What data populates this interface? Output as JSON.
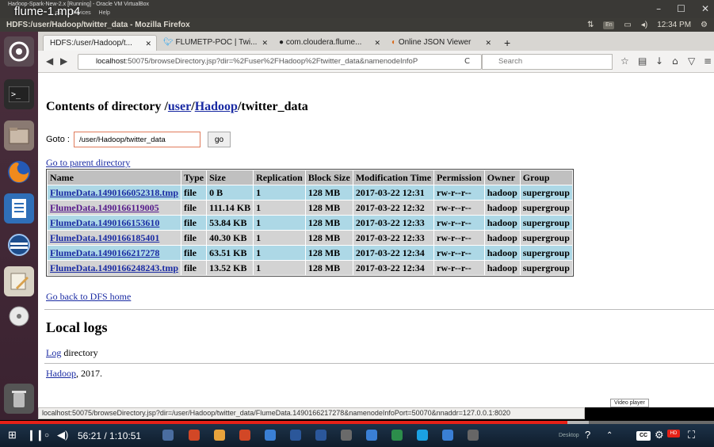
{
  "vbox": {
    "title": "Hadoop-Spark-New-2.x [Running] - Oracle VM VirtualBox",
    "menu": [
      "put",
      "Devices",
      "Help"
    ],
    "video_title": "flume-1.mp4"
  },
  "ubuntu": {
    "window_title": "HDFS:/user/Hadoop/twitter_data - Mozilla Firefox",
    "keyboard": "En",
    "clock": "12:34 PM"
  },
  "tabs": [
    {
      "label": "HDFS:/user/Hadoop/t..."
    },
    {
      "label": "FLUMETP-POC | Twi..."
    },
    {
      "label": "com.cloudera.flume..."
    },
    {
      "label": "Online JSON Viewer"
    }
  ],
  "navbar": {
    "url_host": "localhost",
    "url_rest": ":50075/browseDirectory.jsp?dir=%2Fuser%2FHadoop%2Ftwitter_data&namenodeInfoP",
    "search_placeholder": "Search"
  },
  "page": {
    "heading_prefix": "Contents of directory /",
    "heading_link1": "user",
    "heading_sep": "/",
    "heading_link2": "Hadoop",
    "heading_suffix": "/twitter_data",
    "goto_label": "Goto :",
    "goto_value": "/user/Hadoop/twitter_data",
    "goto_button": "go",
    "parent_link": "Go to parent directory",
    "columns": [
      "Name",
      "Type",
      "Size",
      "Replication",
      "Block Size",
      "Modification Time",
      "Permission",
      "Owner",
      "Group"
    ],
    "rows": [
      [
        "FlumeData.1490166052318.tmp",
        "file",
        "0 B",
        "1",
        "128 MB",
        "2017-03-22 12:31",
        "rw-r--r--",
        "hadoop",
        "supergroup"
      ],
      [
        "FlumeData.1490166119005",
        "file",
        "111.14 KB",
        "1",
        "128 MB",
        "2017-03-22 12:32",
        "rw-r--r--",
        "hadoop",
        "supergroup"
      ],
      [
        "FlumeData.1490166153610",
        "file",
        "53.84 KB",
        "1",
        "128 MB",
        "2017-03-22 12:33",
        "rw-r--r--",
        "hadoop",
        "supergroup"
      ],
      [
        "FlumeData.1490166185401",
        "file",
        "40.30 KB",
        "1",
        "128 MB",
        "2017-03-22 12:33",
        "rw-r--r--",
        "hadoop",
        "supergroup"
      ],
      [
        "FlumeData.1490166217278",
        "file",
        "63.51 KB",
        "1",
        "128 MB",
        "2017-03-22 12:34",
        "rw-r--r--",
        "hadoop",
        "supergroup"
      ],
      [
        "FlumeData.1490166248243.tmp",
        "file",
        "13.52 KB",
        "1",
        "128 MB",
        "2017-03-22 12:34",
        "rw-r--r--",
        "hadoop",
        "supergroup"
      ]
    ],
    "dfs_home": "Go back to DFS home",
    "local_logs": "Local logs",
    "log_link": "Log",
    "log_suffix": " directory",
    "footer_link": "Hadoop",
    "footer_suffix": ", 2017."
  },
  "status_link": "localhost:50075/browseDirectory.jsp?dir=/user/Hadoop/twitter_data/FlumeData.1490166217278&namenodeInfoPort=50070&nnaddr=127.0.0.1:8020",
  "tooltip": "Video player",
  "player": {
    "time": "56:21 / 1:10:51",
    "progress_fraction": 0.795,
    "desktop_label": "Desktop",
    "cc_label": "CC",
    "hd_label": "HD"
  },
  "colors": {
    "row_blue": "#add8e6",
    "row_grey": "#d3d3d3",
    "link": "#1a2ba3",
    "progress": "#e62117"
  }
}
